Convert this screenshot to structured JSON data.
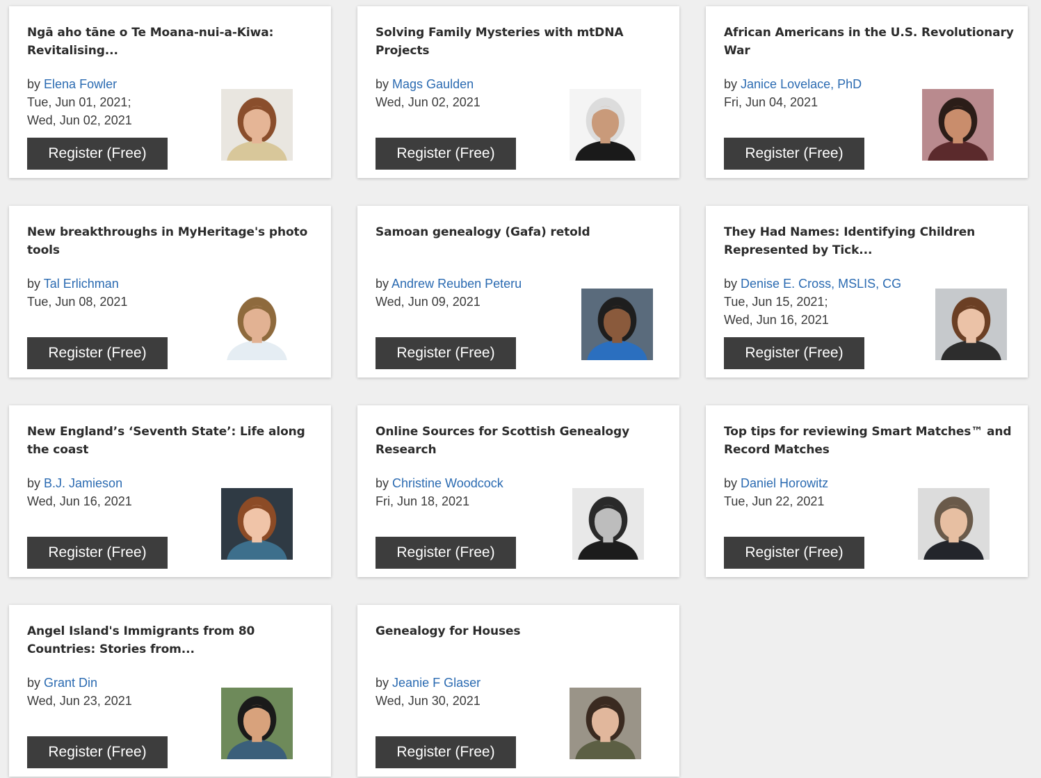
{
  "cards": [
    {
      "title": "Ngā aho tāne o Te Moana-nui-a-Kiwa: Revitalising...",
      "by": "by",
      "speaker": "Elena Fowler",
      "dates": [
        "Tue, Jun 01, 2021;",
        "Wed, Jun 02, 2021"
      ],
      "button": "Register (Free)",
      "photo": {
        "bg": "#e9e6e0",
        "skin": "#e5b596",
        "hair": "#8a4e2c",
        "shirt": "#d8c79a"
      }
    },
    {
      "title": "Solving Family Mysteries with mtDNA Projects",
      "by": "by",
      "speaker": "Mags Gaulden",
      "dates": [
        "Wed, Jun 02, 2021"
      ],
      "button": "Register (Free)",
      "photo": {
        "bg": "#f4f4f4",
        "skin": "#c99a7a",
        "hair": "#dcdcdc",
        "shirt": "#1a1a1a"
      }
    },
    {
      "title": "African Americans in the U.S. Revolutionary War",
      "by": "by",
      "speaker": "Janice Lovelace, PhD",
      "dates": [
        "Fri, Jun 04, 2021"
      ],
      "button": "Register (Free)",
      "photo": {
        "bg": "#b98a8e",
        "skin": "#c98d6c",
        "hair": "#2b1d18",
        "shirt": "#5b2a2c"
      }
    },
    {
      "title": "New breakthroughs in MyHeritage's photo tools",
      "by": "by",
      "speaker": "Tal Erlichman",
      "dates": [
        "Tue, Jun 08, 2021"
      ],
      "button": "Register (Free)",
      "photo": {
        "bg": "#ffffff",
        "skin": "#e2b293",
        "hair": "#8e6a3d",
        "shirt": "#e5edf3"
      }
    },
    {
      "title": "Samoan genealogy (Gafa) retold",
      "by": "by",
      "speaker": "Andrew Reuben Peteru",
      "dates": [
        "Wed, Jun 09, 2021"
      ],
      "button": "Register (Free)",
      "photo": {
        "bg": "#5a6b7c",
        "skin": "#8a5a3c",
        "hair": "#1e1e1e",
        "shirt": "#2b6fbf"
      }
    },
    {
      "title": "They Had Names: Identifying Children Represented by Tick...",
      "by": "by",
      "speaker": "Denise E. Cross, MSLIS, CG",
      "dates": [
        "Tue, Jun 15, 2021;",
        "Wed, Jun 16, 2021"
      ],
      "button": "Register (Free)",
      "photo": {
        "bg": "#c6c9cc",
        "skin": "#ebc2a7",
        "hair": "#6b3f24",
        "shirt": "#2d2d2d"
      }
    },
    {
      "title": "New England’s ‘Seventh State’: Life along the coast",
      "by": "by",
      "speaker": "B.J. Jamieson",
      "dates": [
        "Wed, Jun 16, 2021"
      ],
      "button": "Register (Free)",
      "photo": {
        "bg": "#2f3a44",
        "skin": "#f0c4a8",
        "hair": "#8c4b26",
        "shirt": "#3d6f8c"
      }
    },
    {
      "title": "Online Sources for Scottish Genealogy Research",
      "by": "by",
      "speaker": "Christine Woodcock",
      "dates": [
        "Fri, Jun 18, 2021"
      ],
      "button": "Register (Free)",
      "photo": {
        "bg": "#e8e8e8",
        "skin": "#bdbdbd",
        "hair": "#2a2a2a",
        "shirt": "#1c1c1c"
      }
    },
    {
      "title": "Top tips for reviewing Smart Matches™ and Record Matches",
      "by": "by",
      "speaker": "Daniel Horowitz",
      "dates": [
        "Tue, Jun 22, 2021"
      ],
      "button": "Register (Free)",
      "photo": {
        "bg": "#dcdcdc",
        "skin": "#e7bfa2",
        "hair": "#6a5a4a",
        "shirt": "#23252b"
      }
    },
    {
      "title": "Angel Island's Immigrants from 80 Countries: Stories from...",
      "by": "by",
      "speaker": "Grant Din",
      "dates": [
        "Wed, Jun 23, 2021"
      ],
      "button": "Register (Free)",
      "photo": {
        "bg": "#6e8a5a",
        "skin": "#d8a27c",
        "hair": "#1a1a1a",
        "shirt": "#3b5f7a"
      }
    },
    {
      "title": "Genealogy for Houses",
      "by": "by",
      "speaker": "Jeanie F Glaser",
      "dates": [
        "Wed, Jun 30, 2021"
      ],
      "button": "Register (Free)",
      "photo": {
        "bg": "#9a9488",
        "skin": "#e1b79c",
        "hair": "#3a2a20",
        "shirt": "#5c5f44"
      }
    }
  ]
}
